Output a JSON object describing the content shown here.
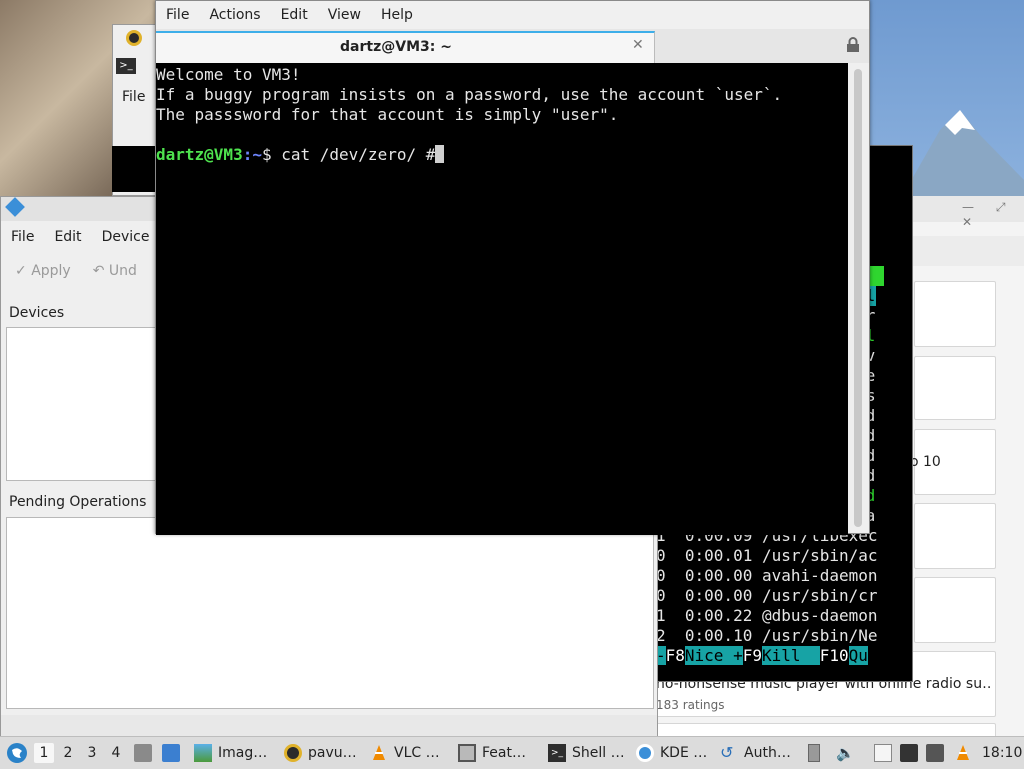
{
  "terminal": {
    "menu": [
      "File",
      "Actions",
      "Edit",
      "View",
      "Help"
    ],
    "tab_title": "dartz@VM3: ~",
    "lines": [
      "Welcome to VM3!",
      "If a buggy program insists on a password, use the account `user`.",
      "The passsword for that account is simply \"user\"."
    ],
    "prompt_user": "dartz@VM3",
    "prompt_path": ":~",
    "prompt_symbol": "$ ",
    "command": "cat /dev/zero/ #"
  },
  "partition_manager": {
    "menu": [
      "File",
      "Edit",
      "Device"
    ],
    "toolbar": {
      "apply": "Apply",
      "undo": "Und"
    },
    "devices_label": "Devices",
    "pending_label": "Pending Operations"
  },
  "behind": {
    "file_menu": "File"
  },
  "htop": {
    "partial_lines": [
      "ul",
      "or",
      "ul",
      "av",
      "te",
      "s",
      "nd",
      "nd",
      "nd",
      "nd",
      "nd",
      "na"
    ],
    "process_lines": [
      "1  0:00.09 /usr/libexec",
      "0  0:00.01 /usr/sbin/ac",
      "0  0:00.00 avahi-daemon",
      "0  0:00.00 /usr/sbin/cr",
      "1  0:00.22 @dbus-daemon",
      "2  0:00.10 /usr/sbin/Ne"
    ],
    "fn_bar": {
      "f7_tail": "-",
      "f8_key": "F8",
      "f8_label": "Nice +",
      "f9_key": "F9",
      "f9_label": "Kill  ",
      "f10_key": "F10",
      "f10_label": "Qu"
    }
  },
  "discover": {
    "partial_text": "o 10",
    "app_description": "no-nonsense music player with online radio su…",
    "rating": "183 ratings"
  },
  "taskbar": {
    "workspaces": [
      "1",
      "2",
      "3",
      "4"
    ],
    "active_workspace": "1",
    "tasks": [
      {
        "label": "Imag…",
        "icon": "image-viewer-icon"
      },
      {
        "label": "pavu…",
        "icon": "pavucontrol-icon"
      },
      {
        "label": "VLC …",
        "icon": "vlc-icon"
      },
      {
        "label": "Feat…",
        "icon": "briefcase-icon"
      },
      {
        "label": "Shell …",
        "icon": "terminal-icon"
      },
      {
        "label": "KDE …",
        "icon": "kde-partition-icon"
      },
      {
        "label": "Auth…",
        "icon": "auth-icon"
      }
    ],
    "clock": "18:10"
  },
  "colors": {
    "terminal_bg": "#000000",
    "prompt_user": "#4ee24e",
    "prompt_path": "#6f86ff",
    "tab_accent": "#3daee9",
    "htop_fn_label": "#17a3a5"
  }
}
